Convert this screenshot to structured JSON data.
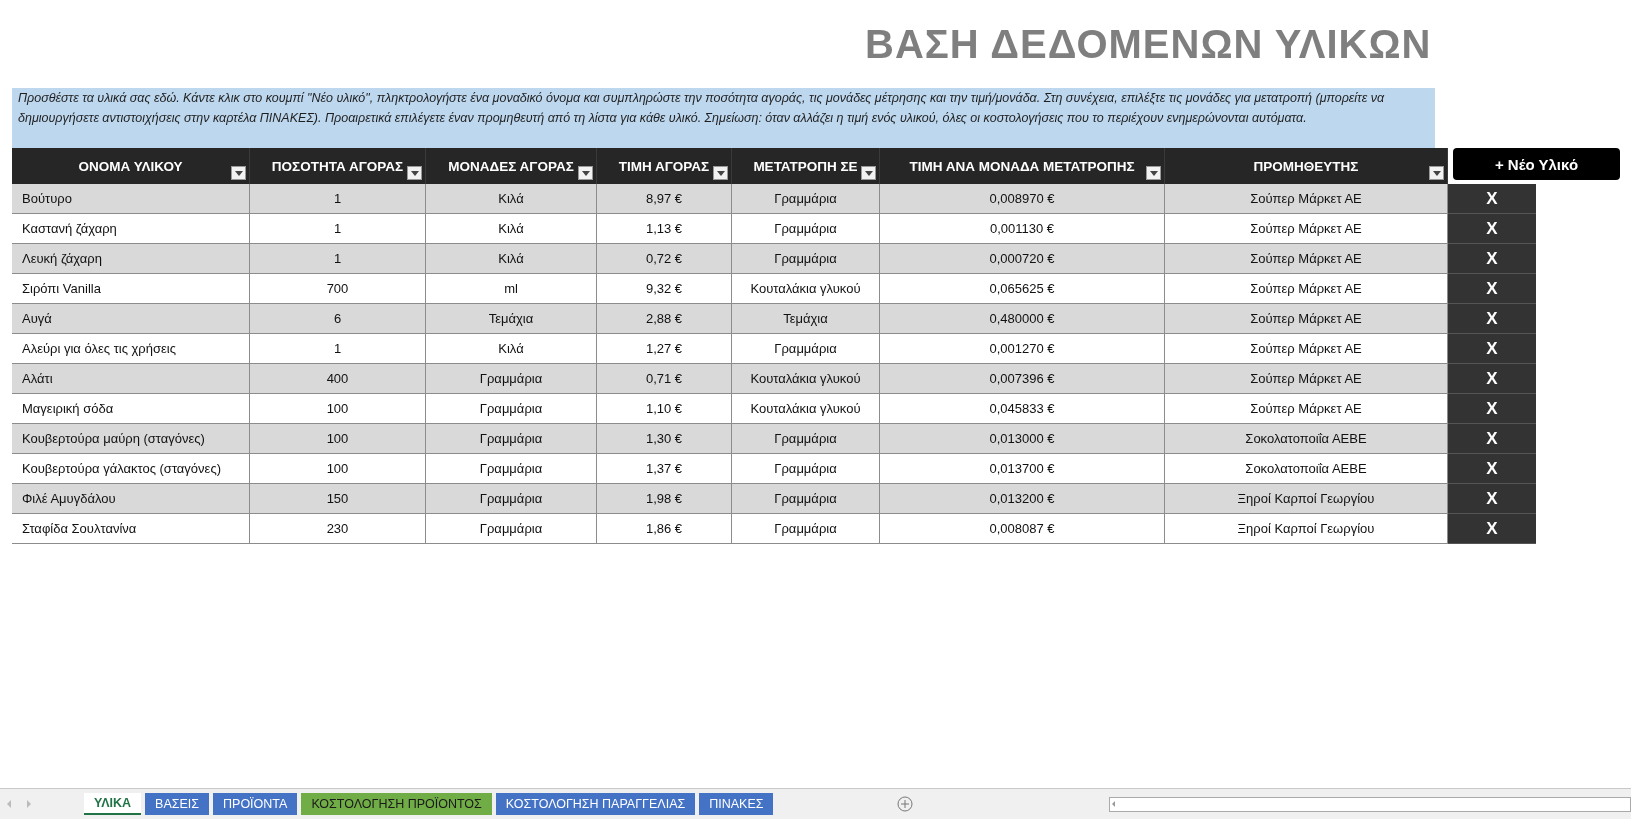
{
  "title": "ΒΑΣΗ ΔΕΔΟΜΕΝΩΝ ΥΛΙΚΩΝ",
  "instructions": "Προσθέστε τα υλικά σας εδώ. Κάντε κλικ στο κουμπί \"Νέο υλικό\", πληκτρολογήστε ένα μοναδικό όνομα και συμπληρώστε την ποσότητα αγοράς, τις μονάδες μέτρησης και την τιμή/μονάδα. Στη συνέχεια, επιλέξτε τις μονάδες για μετατροπή (μπορείτε να δημιουργήσετε αντιστοιχήσεις στην καρτέλα ΠΙΝΑΚΕΣ). Προαιρετικά επιλέγετε έναν προμηθευτή από τη λίστα για κάθε υλικό. Σημείωση: όταν αλλάζει η τιμή ενός υλικού, όλες οι κοστολογήσεις που το περιέχουν ενημερώνονται αυτόματα.",
  "new_button": "+ Νέο Υλικό",
  "table": {
    "columns": [
      "ΟΝΟΜΑ ΥΛΙΚΟΥ",
      "ΠΟΣΟΤΗΤΑ ΑΓΟΡΑΣ",
      "ΜΟΝΑΔΕΣ ΑΓΟΡΑΣ",
      "ΤΙΜΗ ΑΓΟΡΑΣ",
      "ΜΕΤΑΤΡΟΠΗ ΣΕ",
      "ΤΙΜΗ ΑΝΑ ΜΟΝΑΔΑ ΜΕΤΑΤΡΟΠΗΣ",
      "ΠΡΟΜΗΘΕΥΤΗΣ"
    ],
    "rows": [
      {
        "cells": [
          "Βούτυρο",
          "1",
          "Κιλά",
          "8,97 €",
          "Γραμμάρια",
          "0,008970 €",
          "Σούπερ Μάρκετ ΑΕ"
        ],
        "delete": "X"
      },
      {
        "cells": [
          "Καστανή ζάχαρη",
          "1",
          "Κιλά",
          "1,13 €",
          "Γραμμάρια",
          "0,001130 €",
          "Σούπερ Μάρκετ ΑΕ"
        ],
        "delete": "X"
      },
      {
        "cells": [
          "Λευκή ζάχαρη",
          "1",
          "Κιλά",
          "0,72 €",
          "Γραμμάρια",
          "0,000720 €",
          "Σούπερ Μάρκετ ΑΕ"
        ],
        "delete": "X"
      },
      {
        "cells": [
          "Σιρόπι Vanilla",
          "700",
          "ml",
          "9,32 €",
          "Κουταλάκια γλυκού",
          "0,065625 €",
          "Σούπερ Μάρκετ ΑΕ"
        ],
        "delete": "X"
      },
      {
        "cells": [
          "Αυγά",
          "6",
          "Τεμάχια",
          "2,88 €",
          "Τεμάχια",
          "0,480000 €",
          "Σούπερ Μάρκετ ΑΕ"
        ],
        "delete": "X"
      },
      {
        "cells": [
          "Αλεύρι για όλες τις χρήσεις",
          "1",
          "Κιλά",
          "1,27 €",
          "Γραμμάρια",
          "0,001270 €",
          "Σούπερ Μάρκετ ΑΕ"
        ],
        "delete": "X"
      },
      {
        "cells": [
          "Αλάτι",
          "400",
          "Γραμμάρια",
          "0,71 €",
          "Κουταλάκια γλυκού",
          "0,007396 €",
          "Σούπερ Μάρκετ ΑΕ"
        ],
        "delete": "X"
      },
      {
        "cells": [
          "Μαγειρική σόδα",
          "100",
          "Γραμμάρια",
          "1,10 €",
          "Κουταλάκια γλυκού",
          "0,045833 €",
          "Σούπερ Μάρκετ ΑΕ"
        ],
        "delete": "X"
      },
      {
        "cells": [
          "Κουβερτούρα μαύρη (σταγόνες)",
          "100",
          "Γραμμάρια",
          "1,30 €",
          "Γραμμάρια",
          "0,013000 €",
          "Σοκολατοποιΐα ΑΕΒΕ"
        ],
        "delete": "X"
      },
      {
        "cells": [
          "Κουβερτούρα γάλακτος (σταγόνες)",
          "100",
          "Γραμμάρια",
          "1,37 €",
          "Γραμμάρια",
          "0,013700 €",
          "Σοκολατοποιΐα ΑΕΒΕ"
        ],
        "delete": "X"
      },
      {
        "cells": [
          "Φιλέ Αμυγδάλου",
          "150",
          "Γραμμάρια",
          "1,98 €",
          "Γραμμάρια",
          "0,013200 €",
          "Ξηροί Καρποί Γεωργίου"
        ],
        "delete": "X"
      },
      {
        "cells": [
          "Σταφίδα Σουλτανίνα",
          "230",
          "Γραμμάρια",
          "1,86 €",
          "Γραμμάρια",
          "0,008087 €",
          "Ξηροί Καρποί Γεωργίου"
        ],
        "delete": "X"
      }
    ]
  },
  "sheet_tabs": [
    {
      "label": "ΥΛΙΚΑ",
      "selected": true,
      "color": "#ffffff"
    },
    {
      "label": "ΒΑΣΕΙΣ",
      "selected": false,
      "color": "#4472c4"
    },
    {
      "label": "ΠΡΟΪΟΝΤΑ",
      "selected": false,
      "color": "#4472c4"
    },
    {
      "label": "ΚΟΣΤΟΛΟΓΗΣΗ ΠΡΟΪΟΝΤΟΣ",
      "selected": false,
      "color": "#70ad47"
    },
    {
      "label": "ΚΟΣΤΟΛΟΓΗΣΗ ΠΑΡΑΓΓΕΛΙΑΣ",
      "selected": false,
      "color": "#4472c4"
    },
    {
      "label": "ΠΙΝΑΚΕΣ",
      "selected": false,
      "color": "#4472c4"
    }
  ]
}
